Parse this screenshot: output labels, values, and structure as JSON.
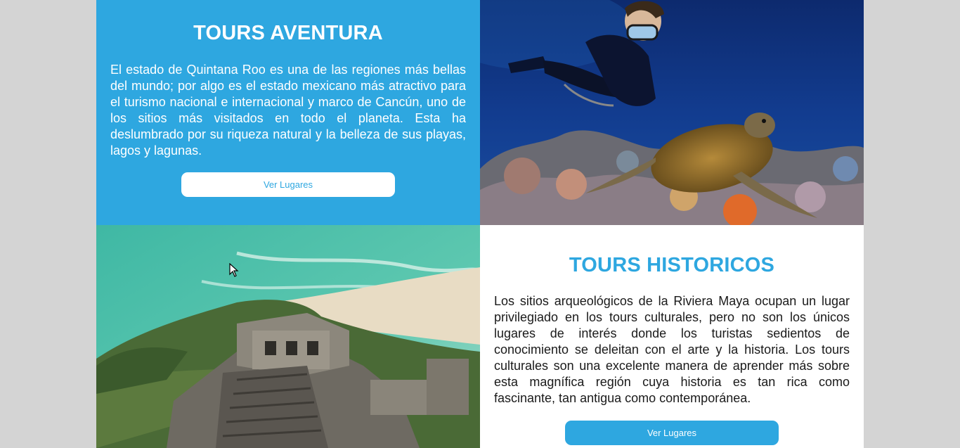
{
  "adventure": {
    "title": "TOURS AVENTURA",
    "text": "El estado de Quintana Roo es una de las regiones más bellas del mundo; por algo es el estado mexicano más atractivo para el turismo nacional e internacional y marco de Cancún, uno de los sitios más visitados en todo el planeta. Esta ha deslumbrado por su riqueza natural y la belleza de sus playas, lagos y lagunas.",
    "button_label": "Ver Lugares"
  },
  "historic": {
    "title": "TOURS HISTORICOS",
    "text": "Los sitios arqueológicos de la Riviera Maya ocupan un lugar privilegiado en los tours culturales, pero no son los únicos lugares de interés donde los turistas sedientos de conocimiento se deleitan con el arte y la historia. Los tours culturales son una excelente manera de aprender más sobre esta magnífica región cuya historia es tan rica como fascinante, tan antigua como contemporánea.",
    "button_label": "Ver Lugares"
  },
  "colors": {
    "accent": "#2ea7e0",
    "background": "#d4d4d4",
    "white": "#ffffff"
  }
}
